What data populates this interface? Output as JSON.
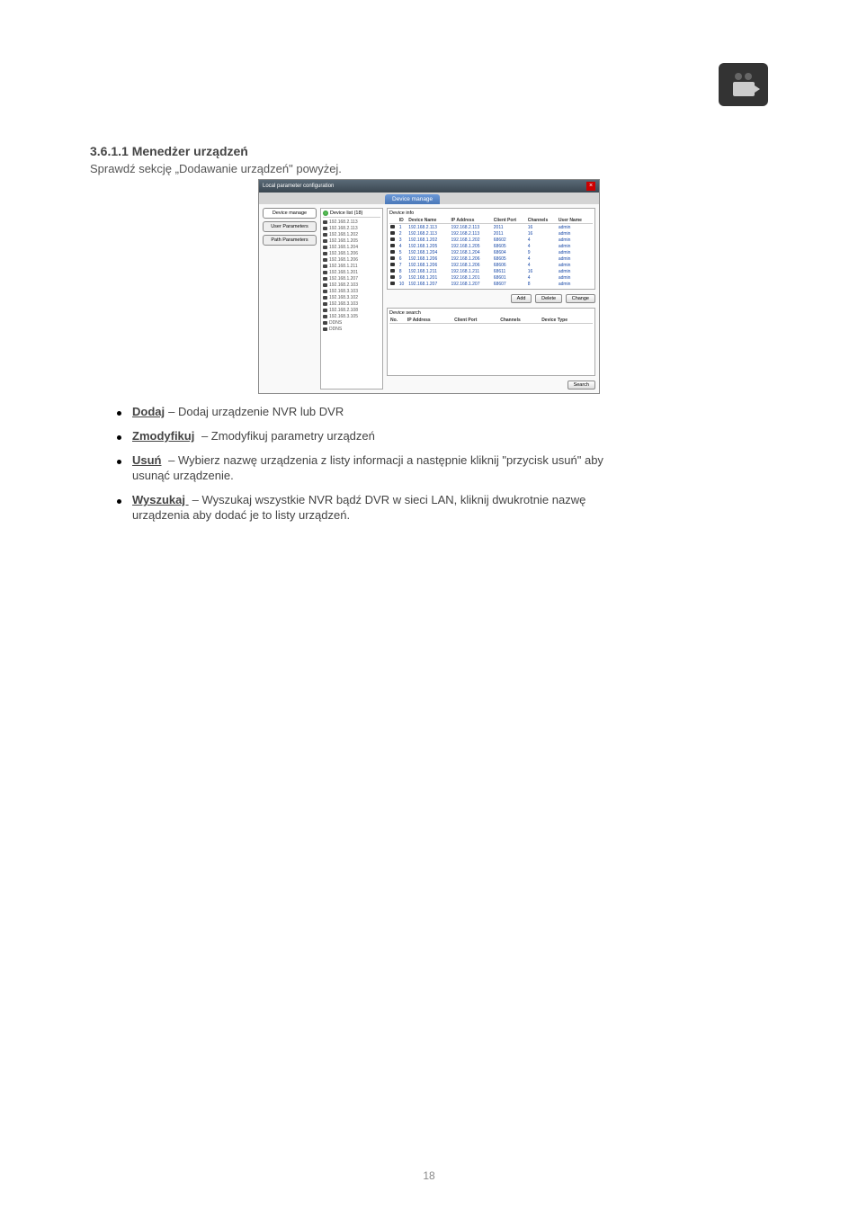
{
  "logo_name": "camera-logo",
  "section_title": "3.6.1.1 Menedżer urządzeń",
  "section_intro": "Sprawdź sekcję „Dodawanie urządzeń\" powyżej.",
  "screenshot": {
    "window_title": "Local parameter configuration",
    "tab_label": "Device manage",
    "nav": {
      "device_manage": "Device manage",
      "user_parameters": "User Parameters",
      "path_parameters": "Path Parameters"
    },
    "device_list_header": "Device list (18)",
    "device_list": [
      "192.168.2.113",
      "192.168.2.113",
      "192.168.1.202",
      "192.168.1.205",
      "192.168.1.204",
      "192.168.1.206",
      "192.168.1.206",
      "192.168.1.211",
      "192.168.1.201",
      "192.168.1.207",
      "192.168.2.103",
      "192.168.3.103",
      "192.168.3.102",
      "192.168.3.103",
      "192.168.2.108",
      "192.168.3.105",
      "DDNS",
      "DDNS"
    ],
    "device_info_label": "Device info",
    "info_headers": [
      "",
      "ID",
      "Device Name",
      "IP Address",
      "Client Port",
      "Channels",
      "User Name"
    ],
    "info_rows": [
      {
        "id": "1",
        "name": "192.168.2.113",
        "ip": "192.168.2.113",
        "port": "2011",
        "ch": "16",
        "user": "admin"
      },
      {
        "id": "2",
        "name": "192.168.2.113",
        "ip": "192.168.2.113",
        "port": "2011",
        "ch": "16",
        "user": "admin"
      },
      {
        "id": "3",
        "name": "192.168.1.202",
        "ip": "192.168.1.202",
        "port": "68602",
        "ch": "4",
        "user": "admin"
      },
      {
        "id": "4",
        "name": "192.168.1.205",
        "ip": "192.168.1.205",
        "port": "68605",
        "ch": "4",
        "user": "admin"
      },
      {
        "id": "5",
        "name": "192.168.1.204",
        "ip": "192.168.1.204",
        "port": "68604",
        "ch": "9",
        "user": "admin"
      },
      {
        "id": "6",
        "name": "192.168.1.206",
        "ip": "192.168.1.206",
        "port": "68605",
        "ch": "4",
        "user": "admin"
      },
      {
        "id": "7",
        "name": "192.168.1.206",
        "ip": "192.168.1.206",
        "port": "68606",
        "ch": "4",
        "user": "admin"
      },
      {
        "id": "8",
        "name": "192.168.1.211",
        "ip": "192.168.1.211",
        "port": "68611",
        "ch": "16",
        "user": "admin"
      },
      {
        "id": "9",
        "name": "192.168.1.201",
        "ip": "192.168.1.201",
        "port": "68601",
        "ch": "4",
        "user": "admin"
      },
      {
        "id": "10",
        "name": "192.168.1.207",
        "ip": "192.168.1.207",
        "port": "68607",
        "ch": "8",
        "user": "admin"
      }
    ],
    "btn_add": "Add",
    "btn_delete": "Delete",
    "btn_change": "Change",
    "device_search_label": "Device search",
    "search_headers": [
      "No.",
      "IP Address",
      "Client Port",
      "Channels",
      "Device Type"
    ],
    "btn_search": "Search"
  },
  "bullets": [
    {
      "label": "Dodaj",
      "text": "– Dodaj urządzenie NVR lub DVR"
    },
    {
      "label": "Zmodyfikuj",
      "text": " – Zmodyfikuj parametry urządzeń"
    },
    {
      "label": "Usuń",
      "text": " – Wybierz nazwę urządzenia z listy informacji a następnie kliknij \"przycisk usuń\" aby",
      "sub": "usunąć urządzenie."
    },
    {
      "label": "Wyszukaj ",
      "text": "– Wyszukaj wszystkie NVR bądź DVR w sieci LAN, kliknij dwukrotnie nazwę",
      "sub": "urządzenia aby dodać je to listy urządzeń."
    }
  ],
  "page_number": "18",
  "icons": {
    "close": "×"
  }
}
